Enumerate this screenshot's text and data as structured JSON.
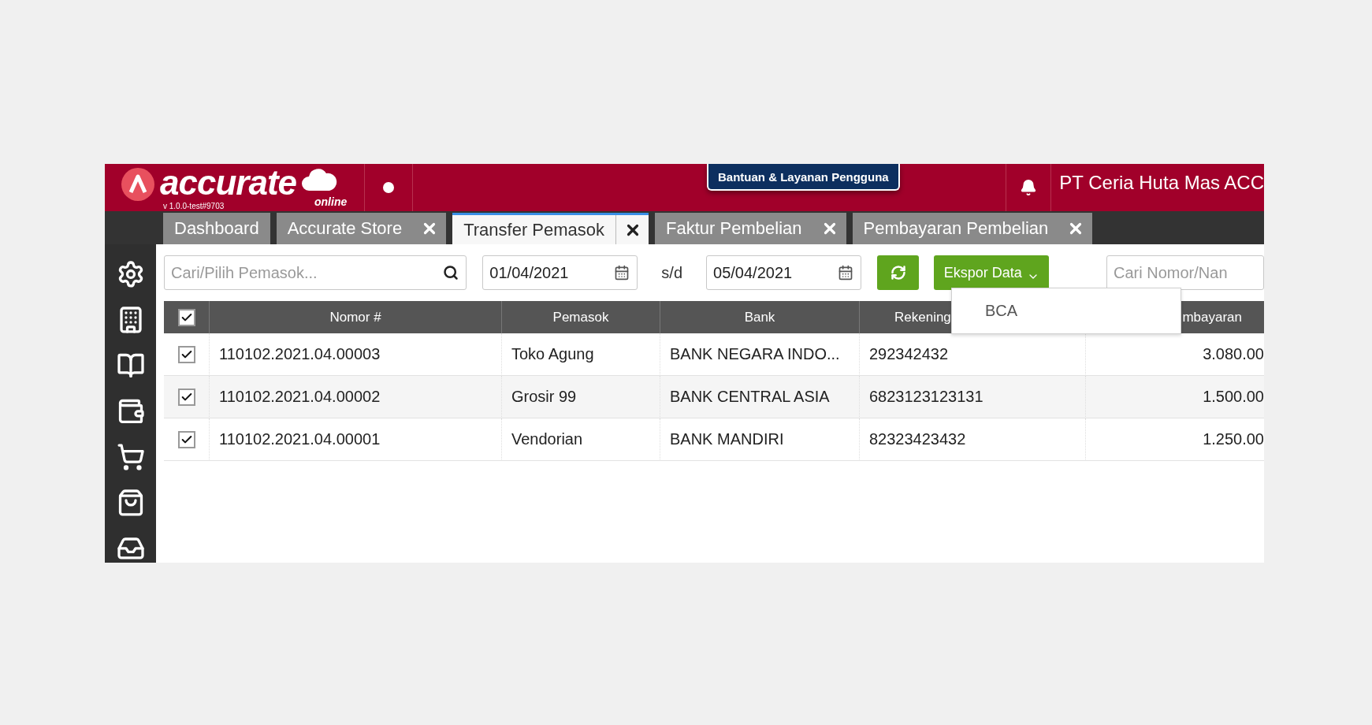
{
  "header": {
    "logo_text": "accurate",
    "logo_sub": "online",
    "version": "v 1.0.0-test#9703",
    "help_button": "Bantuan & Layanan Pengguna",
    "company": "PT Ceria Huta Mas ACC"
  },
  "tabs": [
    {
      "label": "Dashboard",
      "selected": false,
      "closable": false
    },
    {
      "label": "Accurate Store",
      "selected": false,
      "closable": true
    },
    {
      "label": "Transfer Pemasok",
      "selected": true,
      "closable": true
    },
    {
      "label": "Faktur Pembelian",
      "selected": false,
      "closable": true
    },
    {
      "label": "Pembayaran Pembelian",
      "selected": false,
      "closable": true
    }
  ],
  "toolbar": {
    "supplier_search": {
      "placeholder": "Cari/Pilih Pemasok..."
    },
    "date_from": "01/04/2021",
    "range_label": "s/d",
    "date_to": "05/04/2021",
    "export_button": {
      "label": "Ekspor Data",
      "expanded": true,
      "menu": [
        "BCA"
      ]
    },
    "number_search": {
      "placeholder": "Cari Nomor/Nan"
    }
  },
  "table": {
    "all_checked": true,
    "columns": [
      "Nomor #",
      "Pemasok",
      "Bank",
      "Rekening",
      "mbayaran"
    ],
    "rows": [
      {
        "checked": true,
        "cells": [
          "110102.2021.04.00003",
          "Toko Agung",
          "BANK NEGARA INDO...",
          "292342432",
          "3.080.00"
        ]
      },
      {
        "checked": true,
        "cells": [
          "110102.2021.04.00002",
          "Grosir 99",
          "BANK CENTRAL ASIA",
          "6823123123131",
          "1.500.00"
        ]
      },
      {
        "checked": true,
        "cells": [
          "110102.2021.04.00001",
          "Vendorian",
          "BANK MANDIRI",
          "82323423432",
          "1.250.00"
        ]
      }
    ]
  }
}
